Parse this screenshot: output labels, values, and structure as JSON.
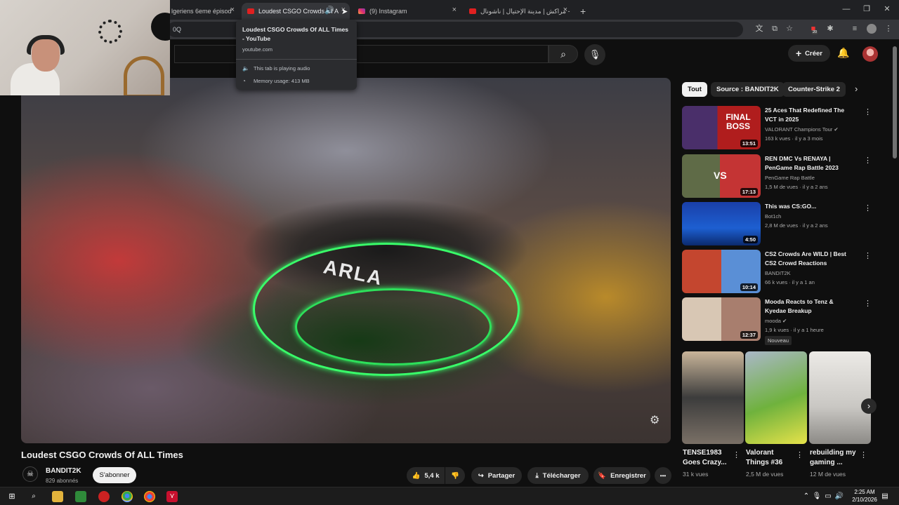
{
  "browser": {
    "tabs": [
      {
        "title": "lgeriens 6eme épisod",
        "close": "×"
      },
      {
        "title": "Loudest CSGO Crowds Of A",
        "close": "×"
      },
      {
        "title": "(9) Instagram",
        "close": "×"
      },
      {
        "title": "مراكش | مدينة الإحتيال | ناشونال -",
        "close": "×"
      }
    ],
    "new_tab": "+",
    "omnibox_text": "0Q",
    "extension_badge": "20",
    "window_controls": [
      "—",
      "❐",
      "✕"
    ]
  },
  "hover_card": {
    "title": "Loudest CSGO Crowds Of ALL Times - YouTube",
    "url": "youtube.com",
    "audio_status": "This tab is playing audio",
    "memory": "Memory usage: 413 MB"
  },
  "header": {
    "create_label": "Créer"
  },
  "video": {
    "title": "Loudest CSGO Crowds Of ALL Times",
    "channel": "BANDIT2K",
    "subscribers": "829 abonnés",
    "subscribe_label": "S'abonner",
    "likes": "5,4 k",
    "share_label": "Partager",
    "download_label": "Télécharger",
    "save_label": "Enregistrer",
    "more_label": "•••",
    "overlay_text": "ARLA"
  },
  "sidebar": {
    "chips": [
      "Tout",
      "Source : BANDIT2K",
      "Counter-Strike 2"
    ],
    "recommendations": [
      {
        "title": "25 Aces That Redefined The VCT in 2025",
        "channel": "VALORANT Champions Tour ✔",
        "stats": "163 k vues · il y a 3 mois",
        "duration": "13:51",
        "thumb_text": "FINAL BOSS"
      },
      {
        "title": "REN DMC Vs RENAYA | PenGame Rap Battle 2023",
        "channel": "PenGame Rap Battle",
        "stats": "1,5 M de vues · il y a 2 ans",
        "duration": "17:13",
        "thumb_text": "VS"
      },
      {
        "title": "This was CS:GO...",
        "channel": "Bot1ch",
        "stats": "2,8 M de vues · il y a 2 ans",
        "duration": "4:50"
      },
      {
        "title": "CS2 Crowds Are WILD | Best CS2 Crowd Reactions",
        "channel": "BANDIT2K",
        "stats": "66 k vues · il y a 1 an",
        "duration": "10:14"
      },
      {
        "title": "Mooda Reacts to Tenz & Kyedae Breakup",
        "channel": "mooda ✔",
        "stats": "1,9 k vues · il y a 1 heure",
        "duration": "12:37",
        "badge": "Nouveau"
      }
    ],
    "shorts": [
      {
        "title": "TENSE1983 Goes Crazy...",
        "views": "31 k vues"
      },
      {
        "title": "Valorant Things #36",
        "views": "2,5 M de vues"
      },
      {
        "title": "rebuilding my gaming ...",
        "views": "12 M de vues"
      }
    ]
  },
  "taskbar": {
    "time": "2:25 AM",
    "date": "2/10/2026"
  },
  "icons": [
    "search-icon",
    "mic-icon",
    "bell-icon",
    "plus-icon",
    "like-icon",
    "dislike-icon",
    "share-icon",
    "download-icon",
    "save-icon",
    "chevron-right-icon",
    "windows-icon"
  ],
  "colors": {
    "background": "#0f0f0f",
    "chrome": "#202124",
    "accent_green": "#39ff6a"
  }
}
